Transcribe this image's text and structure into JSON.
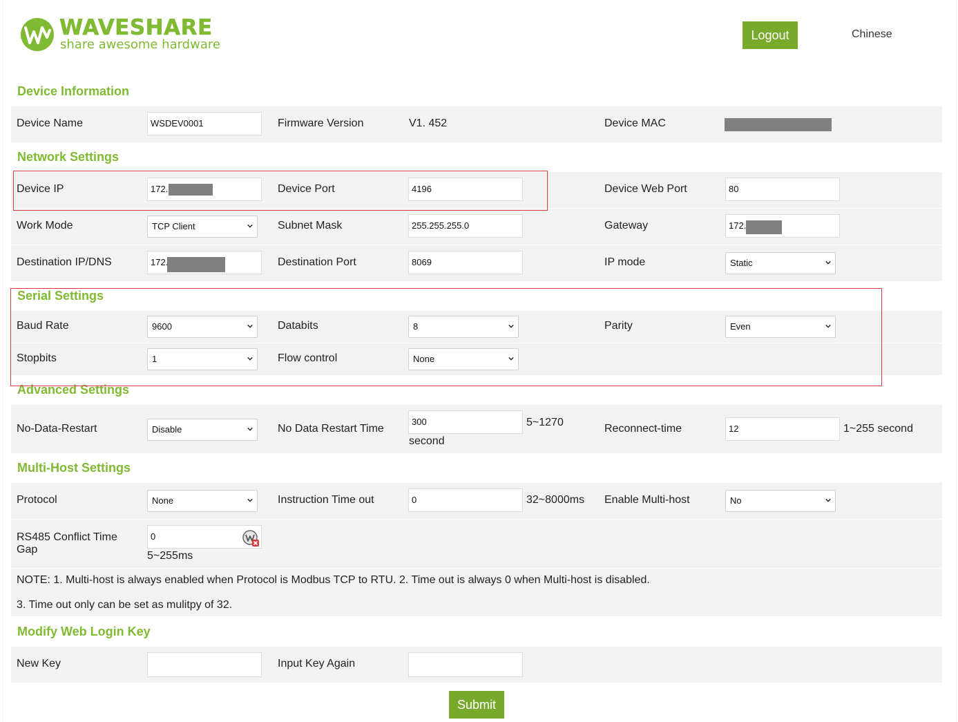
{
  "header": {
    "brand_name": "WAVESHARE",
    "brand_tagline": "share awesome hardware",
    "logout_label": "Logout",
    "language_label": "Chinese",
    "accent_color": "#7fba32"
  },
  "device_info": {
    "title": "Device Information",
    "device_name_label": "Device Name",
    "device_name_value": "WSDEV0001",
    "firmware_label": "Firmware Version",
    "firmware_value": "V1. 452",
    "mac_label": "Device MAC"
  },
  "network": {
    "title": "Network Settings",
    "device_ip_label": "Device IP",
    "device_ip_value": "172.",
    "device_port_label": "Device Port",
    "device_port_value": "4196",
    "web_port_label": "Device Web Port",
    "web_port_value": "80",
    "work_mode_label": "Work Mode",
    "work_mode_value": "TCP Client",
    "subnet_label": "Subnet Mask",
    "subnet_value": "255.255.255.0",
    "gateway_label": "Gateway",
    "gateway_value": "172.",
    "dest_ip_label": "Destination IP/DNS",
    "dest_ip_value": "172.",
    "dest_port_label": "Destination Port",
    "dest_port_value": "8069",
    "ip_mode_label": "IP mode",
    "ip_mode_value": "Static"
  },
  "serial": {
    "title": "Serial Settings",
    "baud_label": "Baud Rate",
    "baud_value": "9600",
    "databits_label": "Databits",
    "databits_value": "8",
    "parity_label": "Parity",
    "parity_value": "Even",
    "stopbits_label": "Stopbits",
    "stopbits_value": "1",
    "flow_label": "Flow control",
    "flow_value": "None"
  },
  "advanced": {
    "title": "Advanced Settings",
    "no_data_restart_label": "No-Data-Restart",
    "no_data_restart_value": "Disable",
    "restart_time_label": "No Data Restart Time",
    "restart_time_value": "300",
    "restart_time_range": "5~1270",
    "restart_time_unit": "second",
    "reconnect_label": "Reconnect-time",
    "reconnect_value": "12",
    "reconnect_range": "1~255 second"
  },
  "multihost": {
    "title": "Multi-Host Settings",
    "protocol_label": "Protocol",
    "protocol_value": "None",
    "timeout_label": "Instruction Time out",
    "timeout_value": "0",
    "timeout_range": "32~8000ms",
    "enable_label": "Enable Multi-host",
    "enable_value": "No",
    "conflict_label_1": "RS485 Conflict Time",
    "conflict_label_2": "Gap",
    "conflict_value": "0",
    "conflict_range": "5~255ms",
    "note_1": "NOTE: 1. Multi-host is always enabled when Protocol is Modbus TCP to RTU. 2. Time out is always 0 when Multi-host is disabled.",
    "note_2": "3. Time out only can be set as mulitpy of 32."
  },
  "login_key": {
    "title": "Modify Web Login Key",
    "new_key_label": "New Key",
    "new_key_value": "",
    "again_label": "Input Key Again",
    "again_value": ""
  },
  "submit_label": "Submit"
}
